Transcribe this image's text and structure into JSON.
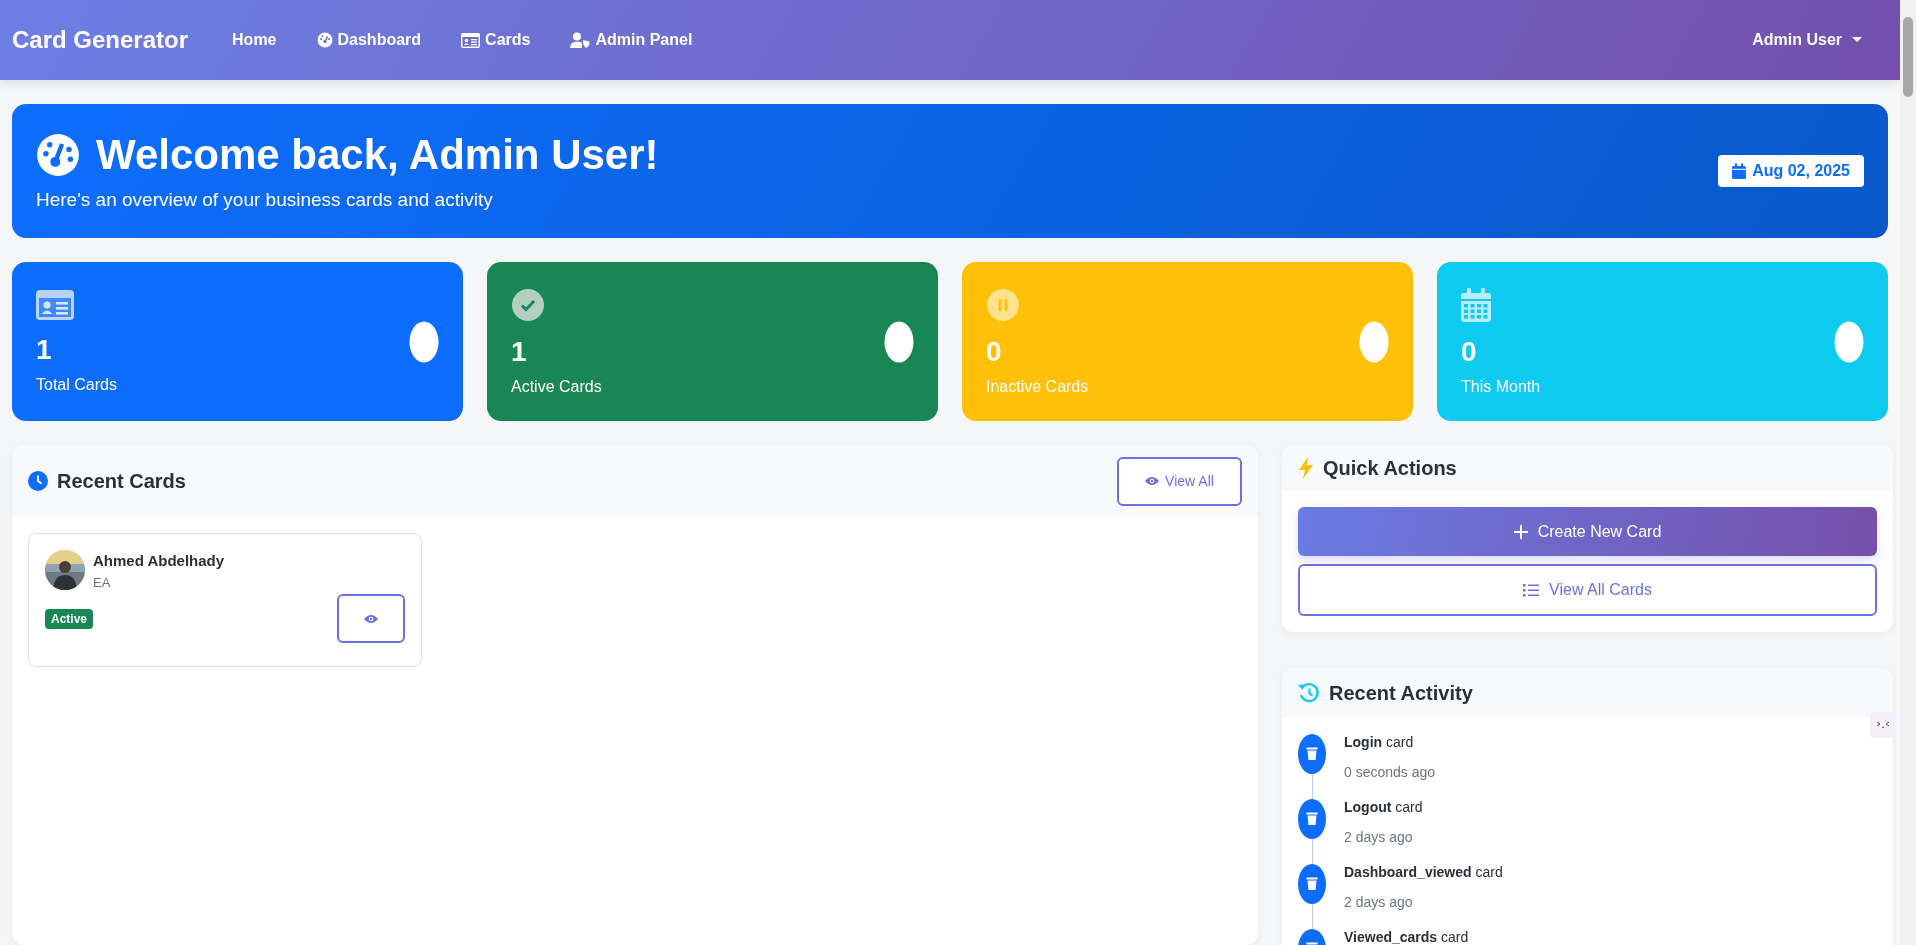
{
  "navbar": {
    "brand": "Card Generator",
    "links": [
      {
        "label": "Home"
      },
      {
        "label": "Dashboard"
      },
      {
        "label": "Cards"
      },
      {
        "label": "Admin Panel"
      }
    ],
    "user": "Admin User"
  },
  "welcome": {
    "title": "Welcome back, Admin User!",
    "subtitle": "Here's an overview of your business cards and activity",
    "date": "Aug 02, 2025"
  },
  "stats": [
    {
      "value": "1",
      "label": "Total Cards",
      "color": "#0d6efd"
    },
    {
      "value": "1",
      "label": "Active Cards",
      "color": "#198754"
    },
    {
      "value": "0",
      "label": "Inactive Cards",
      "color": "#ffc107"
    },
    {
      "value": "0",
      "label": "This Month",
      "color": "#0dcaf0"
    }
  ],
  "recent_cards": {
    "title": "Recent Cards",
    "view_all": "View All",
    "cards": [
      {
        "name": "Ahmed Abdelhady",
        "subtitle": "EA",
        "status": "Active",
        "active": true
      }
    ]
  },
  "quick_actions": {
    "title": "Quick Actions",
    "buttons": [
      {
        "label": "Create New Card",
        "kind": "primary"
      },
      {
        "label": "View All Cards",
        "kind": "outline"
      }
    ]
  },
  "recent_activity": {
    "title": "Recent Activity",
    "items": [
      {
        "text": "**Login** card",
        "time": "0 seconds ago"
      },
      {
        "text": "**Logout** card",
        "time": "2 days ago"
      },
      {
        "text": "**Dashboard_viewed** card",
        "time": "2 days ago"
      },
      {
        "text": "**Viewed_cards** card"
      }
    ]
  }
}
